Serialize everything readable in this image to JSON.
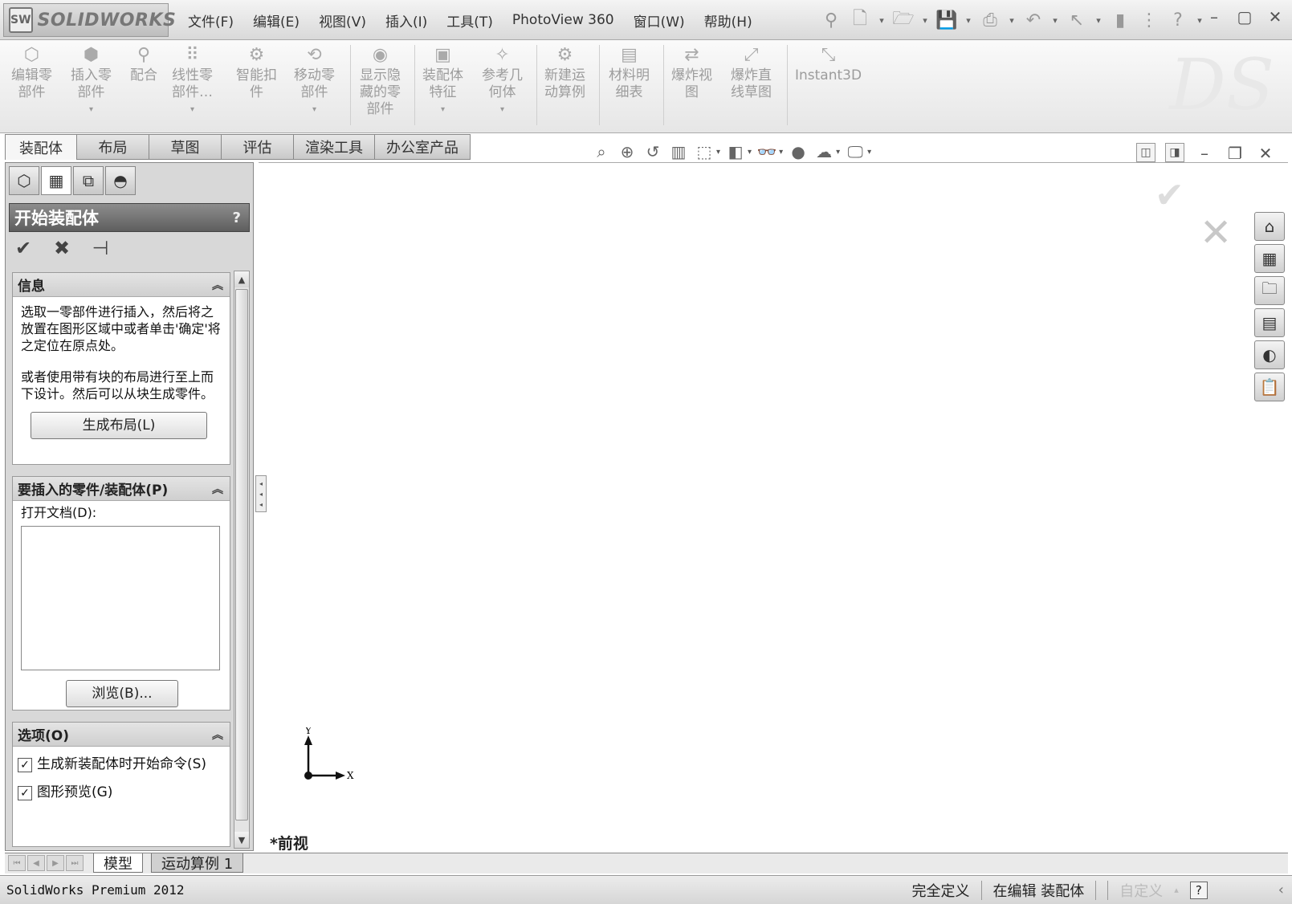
{
  "app": {
    "logo_mark": "SW",
    "logo_text": "SOLIDWORKS"
  },
  "menu": [
    "文件(F)",
    "编辑(E)",
    "视图(V)",
    "插入(I)",
    "工具(T)",
    "PhotoView 360",
    "窗口(W)",
    "帮助(H)"
  ],
  "quick_access_icons": [
    "pin-icon",
    "new-document-icon",
    "open-icon",
    "save-icon",
    "print-icon",
    "undo-icon",
    "select-icon",
    "rebuild-icon",
    "options-icon",
    "help-icon"
  ],
  "ribbon": {
    "buttons": [
      {
        "label": "编辑零\n部件",
        "icon": "edit-component-icon",
        "dropdown": false
      },
      {
        "label": "插入零\n部件",
        "icon": "insert-component-icon",
        "dropdown": true
      },
      {
        "label": "配合",
        "icon": "mate-icon",
        "dropdown": false
      },
      {
        "label": "线性零\n部件…",
        "icon": "linear-pattern-icon",
        "dropdown": true
      },
      {
        "label": "智能扣\n件",
        "icon": "smart-fasteners-icon",
        "dropdown": false
      },
      {
        "label": "移动零\n部件",
        "icon": "move-component-icon",
        "dropdown": true
      },
      {
        "label": "显示隐\n藏的零\n部件",
        "icon": "show-hidden-icon",
        "dropdown": false
      },
      {
        "label": "装配体\n特征",
        "icon": "assembly-feature-icon",
        "dropdown": true
      },
      {
        "label": "参考几\n何体",
        "icon": "reference-geometry-icon",
        "dropdown": true
      },
      {
        "label": "新建运\n动算例",
        "icon": "motion-study-icon",
        "dropdown": false
      },
      {
        "label": "材料明\n细表",
        "icon": "bom-icon",
        "dropdown": false
      },
      {
        "label": "爆炸视\n图",
        "icon": "exploded-view-icon",
        "dropdown": false
      },
      {
        "label": "爆炸直\n线草图",
        "icon": "explode-line-icon",
        "dropdown": false
      },
      {
        "label": "Instant3D",
        "icon": "instant3d-icon",
        "dropdown": false
      }
    ]
  },
  "tabs": [
    "装配体",
    "布局",
    "草图",
    "评估",
    "渲染工具",
    "办公室产品"
  ],
  "active_tab": "装配体",
  "property_manager": {
    "title": "开始装配体",
    "help": "?",
    "info": {
      "header": "信息",
      "paragraph1": "选取一零部件进行插入，然后将之放置在图形区域中或者单击'确定'将之定位在原点处。",
      "paragraph2": "或者使用带有块的布局进行至上而下设计。然后可以从块生成零件。",
      "button": "生成布局(L)"
    },
    "parts": {
      "header": "要插入的零件/装配体(P)",
      "open_docs_label": "打开文档(D):",
      "browse_button": "浏览(B)..."
    },
    "options": {
      "header": "选项(O)",
      "checkbox1": "生成新装配体时开始命令(S)",
      "checkbox1_checked": true,
      "checkbox2": "图形预览(G)",
      "checkbox2_checked": true
    }
  },
  "bottom_tabs": [
    "模型",
    "运动算例 1"
  ],
  "graphics": {
    "view_label": "*前视",
    "axis_x": "X",
    "axis_y": "Y"
  },
  "status": {
    "product": "SolidWorks Premium 2012",
    "state": "完全定义",
    "editing": "在编辑 装配体",
    "units": "自定义",
    "help": "?"
  }
}
